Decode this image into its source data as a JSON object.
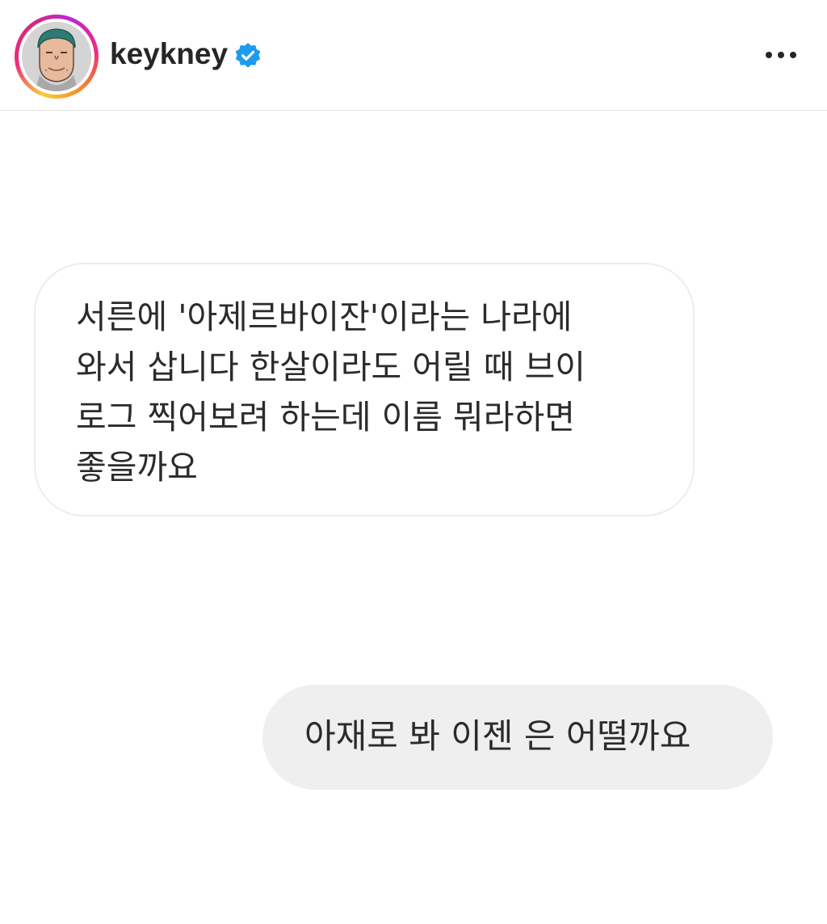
{
  "header": {
    "username": "keykney",
    "verified_icon": "verified-badge-icon",
    "more_icon": "more-options-icon",
    "avatar_icon": "cartoon-face-avatar",
    "colors": {
      "verified": "#1d9bf0",
      "ring_start": "#f9ce34",
      "ring_mid": "#ee2a7b",
      "ring_end": "#c026d3"
    }
  },
  "messages": [
    {
      "direction": "incoming",
      "text": "서른에 '아제르바이잔'이라는 나라에\n와서 삽니다 한살이라도 어릴 때 브이\n로그 찍어보려 하는데 이름 뭐라하면\n좋을까요"
    },
    {
      "direction": "outgoing",
      "text": "아재로 봐 이젠 은 어떨까요"
    }
  ],
  "colors": {
    "incoming_bubble_bg": "#ffffff",
    "incoming_bubble_border": "#ededed",
    "outgoing_bubble_bg": "#efefef",
    "text": "#2b2b2b"
  }
}
